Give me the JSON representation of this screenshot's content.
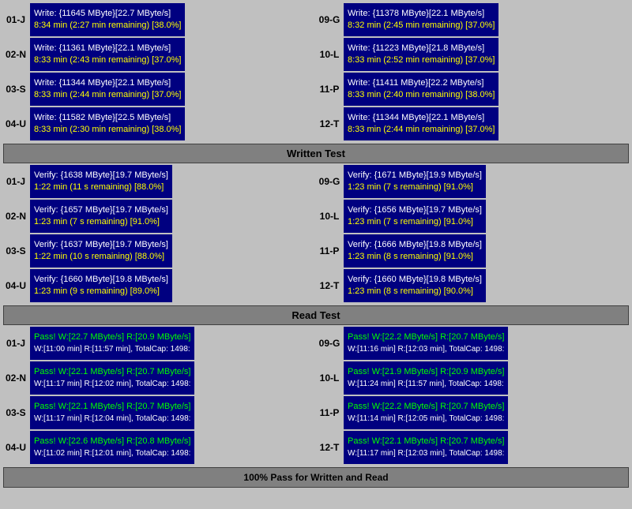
{
  "write_section": {
    "rows": [
      {
        "label": "01-J",
        "line1": "Write: {11645 MByte}[22.7 MByte/s]",
        "line2": "8:34 min (2:27 min remaining)  [38.0%]"
      },
      {
        "label": "09-G",
        "line1": "Write: {11378 MByte}[22.1 MByte/s]",
        "line2": "8:32 min (2:45 min remaining)  [37.0%]"
      },
      {
        "label": "02-N",
        "line1": "Write: {11361 MByte}[22.1 MByte/s]",
        "line2": "8:33 min (2:43 min remaining)  [37.0%]"
      },
      {
        "label": "10-L",
        "line1": "Write: {11223 MByte}[21.8 MByte/s]",
        "line2": "8:33 min (2:52 min remaining)  [37.0%]"
      },
      {
        "label": "03-S",
        "line1": "Write: {11344 MByte}[22.1 MByte/s]",
        "line2": "8:33 min (2:44 min remaining)  [37.0%]"
      },
      {
        "label": "11-P",
        "line1": "Write: {11411 MByte}[22.2 MByte/s]",
        "line2": "8:33 min (2:40 min remaining)  [38.0%]"
      },
      {
        "label": "04-U",
        "line1": "Write: {11582 MByte}[22.5 MByte/s]",
        "line2": "8:33 min (2:30 min remaining)  [38.0%]"
      },
      {
        "label": "12-T",
        "line1": "Write: {11344 MByte}[22.1 MByte/s]",
        "line2": "8:33 min (2:44 min remaining)  [37.0%]"
      }
    ]
  },
  "written_test_header": "Written Test",
  "verify_section": {
    "rows": [
      {
        "label": "01-J",
        "line1": "Verify: {1638 MByte}[19.7 MByte/s]",
        "line2": "1:22 min (11 s remaining)  [88.0%]"
      },
      {
        "label": "09-G",
        "line1": "Verify: {1671 MByte}[19.9 MByte/s]",
        "line2": "1:23 min (7 s remaining)  [91.0%]"
      },
      {
        "label": "02-N",
        "line1": "Verify: {1657 MByte}[19.7 MByte/s]",
        "line2": "1:23 min (7 s remaining)  [91.0%]"
      },
      {
        "label": "10-L",
        "line1": "Verify: {1656 MByte}[19.7 MByte/s]",
        "line2": "1:23 min (7 s remaining)  [91.0%]"
      },
      {
        "label": "03-S",
        "line1": "Verify: {1637 MByte}[19.7 MByte/s]",
        "line2": "1:22 min (10 s remaining)  [88.0%]"
      },
      {
        "label": "11-P",
        "line1": "Verify: {1666 MByte}[19.8 MByte/s]",
        "line2": "1:23 min (8 s remaining)  [91.0%]"
      },
      {
        "label": "04-U",
        "line1": "Verify: {1660 MByte}[19.8 MByte/s]",
        "line2": "1:23 min (9 s remaining)  [89.0%]"
      },
      {
        "label": "12-T",
        "line1": "Verify: {1660 MByte}[19.8 MByte/s]",
        "line2": "1:23 min (8 s remaining)  [90.0%]"
      }
    ]
  },
  "read_test_header": "Read Test",
  "pass_section": {
    "rows": [
      {
        "label": "01-J",
        "line1": "Pass! W:[22.7 MByte/s] R:[20.9 MByte/s]",
        "line2": "W:[11:00 min] R:[11:57 min], TotalCap: 1498:"
      },
      {
        "label": "09-G",
        "line1": "Pass! W:[22.2 MByte/s] R:[20.7 MByte/s]",
        "line2": "W:[11:16 min] R:[12:03 min], TotalCap: 1498:"
      },
      {
        "label": "02-N",
        "line1": "Pass! W:[22.1 MByte/s] R:[20.7 MByte/s]",
        "line2": "W:[11:17 min] R:[12:02 min], TotalCap: 1498:"
      },
      {
        "label": "10-L",
        "line1": "Pass! W:[21.9 MByte/s] R:[20.9 MByte/s]",
        "line2": "W:[11:24 min] R:[11:57 min], TotalCap: 1498:"
      },
      {
        "label": "03-S",
        "line1": "Pass! W:[22.1 MByte/s] R:[20.7 MByte/s]",
        "line2": "W:[11:17 min] R:[12:04 min], TotalCap: 1498:"
      },
      {
        "label": "11-P",
        "line1": "Pass! W:[22.2 MByte/s] R:[20.7 MByte/s]",
        "line2": "W:[11:14 min] R:[12:05 min], TotalCap: 1498:"
      },
      {
        "label": "04-U",
        "line1": "Pass! W:[22.6 MByte/s] R:[20.8 MByte/s]",
        "line2": "W:[11:02 min] R:[12:01 min], TotalCap: 1498:"
      },
      {
        "label": "12-T",
        "line1": "Pass! W:[22.1 MByte/s] R:[20.7 MByte/s]",
        "line2": "W:[11:17 min] R:[12:03 min], TotalCap: 1498:"
      }
    ]
  },
  "status_bar": "100% Pass for Written and Read"
}
